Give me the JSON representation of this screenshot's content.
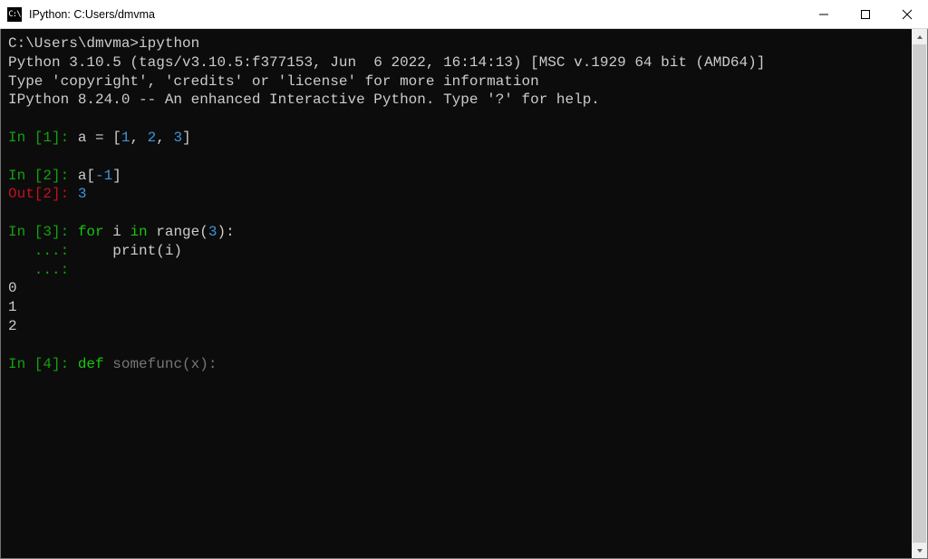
{
  "window": {
    "title": "IPython: C:Users/dmvma",
    "icon_label": "C:\\"
  },
  "terminal": {
    "prompt_path": "C:\\Users\\dmvma>",
    "prompt_cmd": "ipython",
    "banner_line1_a": "Python 3.10.5 (tags/v3.10.5:f377153, Jun  6 2022, 16:14:13) [MSC v.1929 64 bit (AMD64)]",
    "banner_line2": "Type 'copyright', 'credits' or 'license' for more information",
    "banner_line3": "IPython 8.24.0 -- An enhanced Interactive Python. Type '?' for help.",
    "in1_prompt": "In [1]: ",
    "in1_code_a": "a = [",
    "in1_code_n1": "1",
    "in1_code_n2": "2",
    "in1_code_n3": "3",
    "in1_code_sep": ", ",
    "in1_code_close": "]",
    "in2_prompt": "In [2]: ",
    "in2_code_a": "a[",
    "in2_code_idx": "-1",
    "in2_code_close": "]",
    "out2_prompt": "Out[2]: ",
    "out2_val": "3",
    "in3_prompt": "In [3]: ",
    "in3_kw_for": "for",
    "in3_var_i": " i ",
    "in3_kw_in": "in",
    "in3_call": " range(",
    "in3_arg": "3",
    "in3_call_close": "):",
    "cont_prompt": "   ...: ",
    "in3_body_indent": "    ",
    "in3_body_print": "print(i)",
    "in3_out_0": "0",
    "in3_out_1": "1",
    "in3_out_2": "2",
    "in4_prompt": "In [4]: ",
    "in4_kw_def": "def",
    "in4_space": " ",
    "in4_funcname": "somefunc",
    "in4_sig": "(x):"
  }
}
